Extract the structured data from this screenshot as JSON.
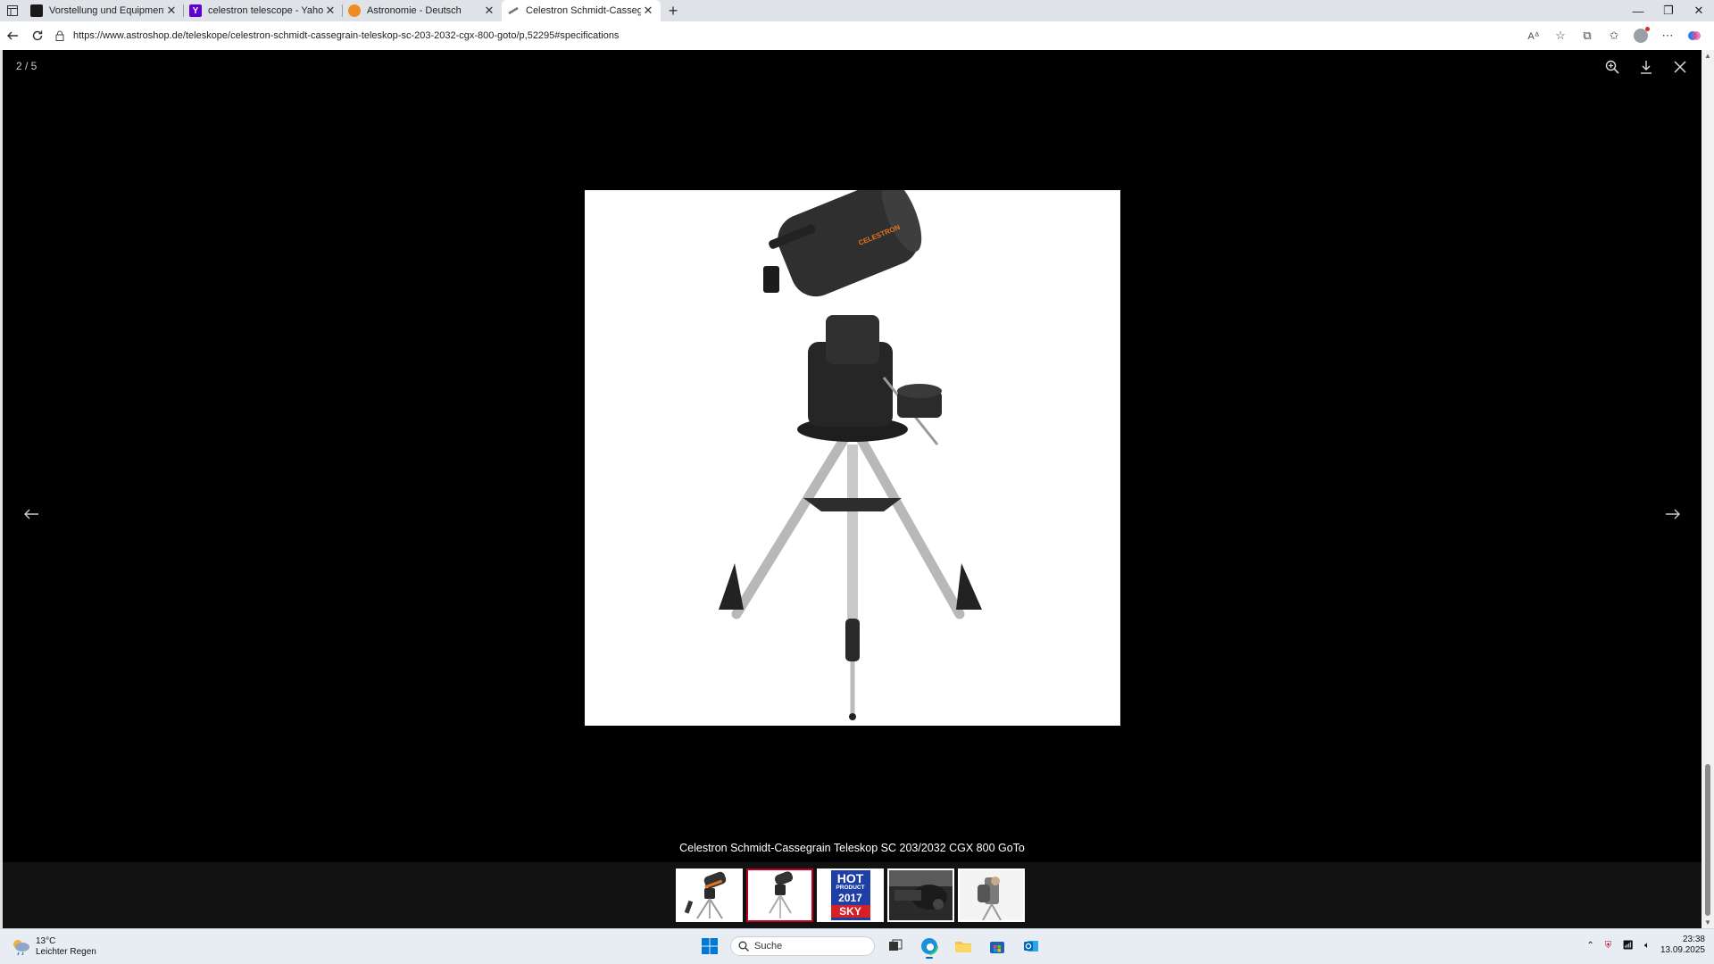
{
  "browser": {
    "tabs": [
      {
        "title": "Vorstellung und Equipmentsuche",
        "favicon_color": "#1a1a1a",
        "active": false
      },
      {
        "title": "celestron telescope - Yahoo Suche",
        "favicon_color": "#6001d2",
        "active": false
      },
      {
        "title": "Astronomie - Deutsch",
        "favicon_color": "#f08a24",
        "active": false
      },
      {
        "title": "Celestron Schmidt-Cassegrain Teleskop",
        "favicon_color": "#888888",
        "active": true
      }
    ],
    "url": "https://www.astroshop.de/teleskope/celestron-schmidt-cassegrain-teleskop-sc-203-2032-cgx-800-goto/p,52295#specifications"
  },
  "lightbox": {
    "counter": "2 / 5",
    "caption": "Celestron Schmidt-Cassegrain Teleskop SC 203/2032 CGX 800 GoTo",
    "brand_label": "CELESTRON",
    "thumbnails": [
      {
        "label": "thumb-1",
        "active": false
      },
      {
        "label": "thumb-2",
        "active": true
      },
      {
        "label": "HOT PRODUCT 2017 SKY",
        "active": false
      },
      {
        "label": "thumb-4",
        "active": false
      },
      {
        "label": "thumb-5",
        "active": false
      }
    ],
    "hot_product": {
      "line1": "HOT",
      "line2": "PRODUCT",
      "line3": "2017",
      "line4": "SKY"
    }
  },
  "taskbar": {
    "weather_temp": "13°C",
    "weather_desc": "Leichter Regen",
    "search_placeholder": "Suche",
    "time": "23:38",
    "date": "13.09.2025"
  },
  "colors": {
    "accent_red": "#c00020",
    "telescope_orange": "#e8731c"
  }
}
